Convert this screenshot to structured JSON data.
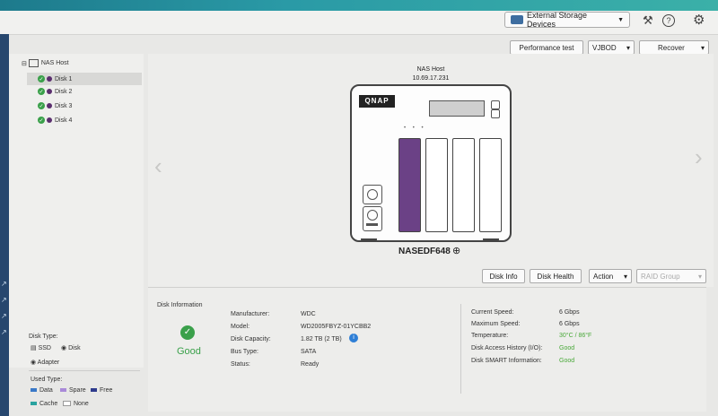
{
  "header": {
    "storage_dropdown": "External Storage Devices"
  },
  "toolbar": {
    "performance_test": "Performance test",
    "vjbod": "VJBOD",
    "recover": "Recover"
  },
  "tree": {
    "root": "NAS Host",
    "disks": [
      "Disk 1",
      "Disk 2",
      "Disk 3",
      "Disk 4"
    ]
  },
  "nas": {
    "title": "NAS Host",
    "ip": "10.69.17.231",
    "brand": "QNAP",
    "name": "NASEDF648"
  },
  "actions": {
    "disk_info": "Disk Info",
    "disk_health": "Disk Health",
    "action": "Action",
    "raid_group": "RAID Group"
  },
  "disk_information": {
    "title": "Disk Information",
    "status_text": "Good",
    "fields": [
      {
        "label": "Manufacturer:",
        "value": "WDC"
      },
      {
        "label": "Model:",
        "value": "WD2005FBYZ-01YCBB2"
      },
      {
        "label": "Disk Capacity:",
        "value": "1.82 TB (2 TB)"
      },
      {
        "label": "Bus Type:",
        "value": "SATA"
      },
      {
        "label": "Status:",
        "value": "Ready"
      }
    ],
    "right_fields": [
      {
        "label": "Current Speed:",
        "value": "6 Gbps"
      },
      {
        "label": "Maximum Speed:",
        "value": "6 Gbps"
      },
      {
        "label": "Temperature:",
        "value": "30°C / 86°F"
      },
      {
        "label": "Disk Access History (I/O):",
        "value": "Good"
      },
      {
        "label": "Disk SMART Information:",
        "value": "Good"
      }
    ]
  },
  "legend": {
    "disk_type_title": "Disk Type:",
    "ssd": "SSD",
    "disk": "Disk",
    "adapter": "Adapter",
    "used_type_title": "Used Type:",
    "data": "Data",
    "spare": "Spare",
    "free": "Free",
    "cache": "Cache",
    "none": "None"
  },
  "colors": {
    "good": "#3aa04a",
    "accent_purple": "#5a2e6e",
    "temp_green": "#48a838"
  }
}
